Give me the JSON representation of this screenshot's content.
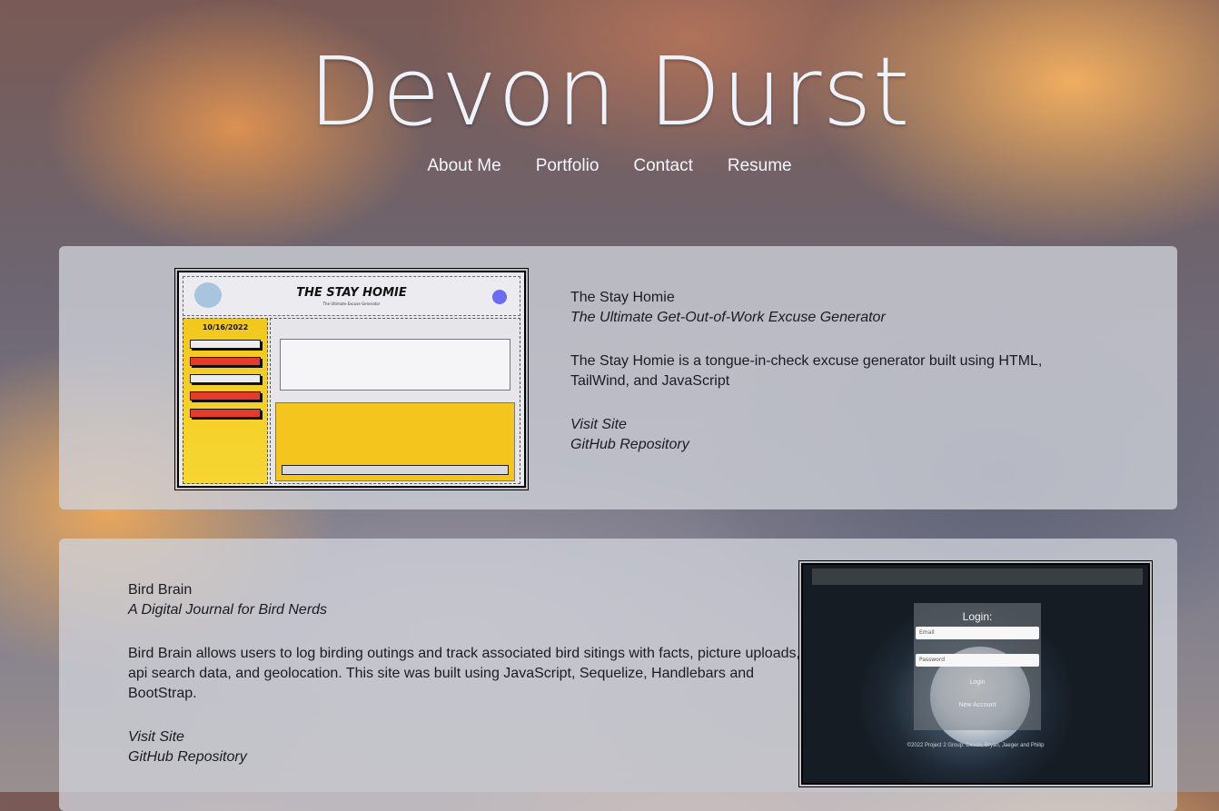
{
  "site": {
    "title": "Devon Durst",
    "nav": [
      "About Me",
      "Portfolio",
      "Contact",
      "Resume"
    ]
  },
  "projects": [
    {
      "title": "The Stay Homie",
      "subtitle": "The Ultimate Get-Out-of-Work Excuse Generator",
      "description": "The Stay Homie is a tongue-in-check excuse generator built using HTML, TailWind, and JavaScript",
      "visit_label": "Visit Site",
      "repo_label": "GitHub Repository",
      "screenshot": {
        "app_title": "THE STAY HOMIE",
        "tagline": "The Ultimate Excuse Generator",
        "date": "10/16/2022"
      }
    },
    {
      "title": "Bird Brain",
      "subtitle": "A Digital Journal for Bird Nerds",
      "description": "Bird Brain allows users to log birding outings and track associated bird sitings with facts, picture uploads, api search data, and geolocation. This site was built using JavaScript, Sequelize, Handlebars and BootStrap.",
      "visit_label": "Visit Site",
      "repo_label": "GitHub Repository",
      "screenshot": {
        "login_title": "Login:",
        "email_placeholder": "Email",
        "password_placeholder": "Password",
        "login_label": "Login",
        "new_account_label": "New Account",
        "footer": "©2022 Project 2 Group: Devon, Bryan, Jaeger and Philip"
      }
    }
  ]
}
